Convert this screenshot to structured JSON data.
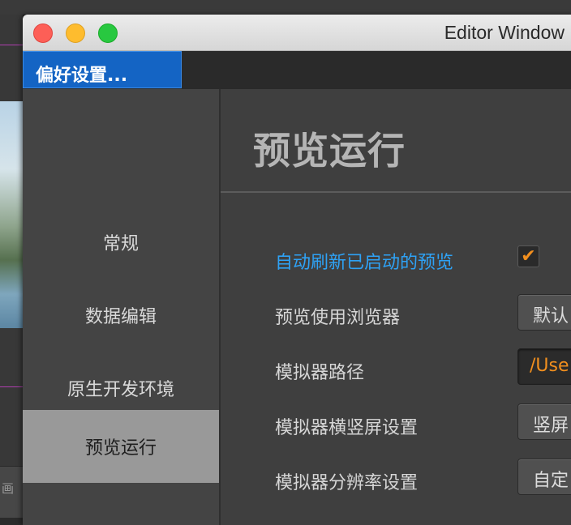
{
  "background": {
    "bottom_label": "画"
  },
  "window": {
    "title": "Editor Window",
    "tab_label": "偏好设置..."
  },
  "sidebar": {
    "items": [
      {
        "label": "常规",
        "active": false
      },
      {
        "label": "数据编辑",
        "active": false
      },
      {
        "label": "原生开发环境",
        "active": false
      },
      {
        "label": "预览运行",
        "active": true
      }
    ]
  },
  "panel": {
    "title": "预览运行",
    "rows": [
      {
        "label": "自动刷新已启动的预览",
        "control": "checkbox",
        "checked": true
      },
      {
        "label": "预览使用浏览器",
        "control": "dropdown",
        "value": "默认"
      },
      {
        "label": "模拟器路径",
        "control": "path",
        "value": "/Use"
      },
      {
        "label": "模拟器横竖屏设置",
        "control": "dropdown",
        "value": "竖屏"
      },
      {
        "label": "模拟器分辨率设置",
        "control": "dropdown",
        "value": "自定"
      }
    ],
    "check_glyph": "✔"
  },
  "colors": {
    "accent_blue": "#2ea2f5",
    "accent_orange": "#f28f1e",
    "tab_blue": "#1464c4",
    "active_nav": "#999999"
  }
}
